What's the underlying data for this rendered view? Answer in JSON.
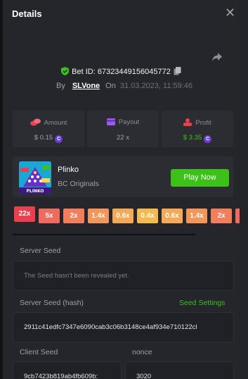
{
  "header": {
    "title": "Details"
  },
  "bet": {
    "id_text": "Bet ID: 67323449156045772",
    "by_label": "By",
    "user": "SLVone",
    "on_label": "On",
    "date": "31.03.2023, 11:59:46"
  },
  "stats": {
    "amount": {
      "label": "Amount",
      "value": "$ 0.15"
    },
    "payout": {
      "label": "Payout",
      "value": "22 x"
    },
    "profit": {
      "label": "Profit",
      "value": "$ 3.35"
    }
  },
  "game": {
    "name": "Plinko",
    "provider": "BC Originals",
    "thumb_text": "PLINKO",
    "play_label": "Play Now"
  },
  "multipliers": [
    "22x",
    "5x",
    "2x",
    "1.4x",
    "0.6x",
    "0.4x",
    "0.6x",
    "1.4x",
    "2x"
  ],
  "server_seed": {
    "label": "Server Seed",
    "value": "The Seed hasn't been revealed yet."
  },
  "server_seed_hash": {
    "label": "Server Seed (hash)",
    "settings_link": "Seed Settings",
    "value": "2911c41edfc7347e6090cab3c06b3148ce4af934e710122cl"
  },
  "client_seed": {
    "label": "Client Seed",
    "value": "9cb7423b819ab4fb609b:"
  },
  "nonce": {
    "label": "nonce",
    "value": "3020"
  },
  "colors": {
    "accent_green": "#3bc117",
    "coin_purple": "#6b3fd4",
    "mult_red": "#e8404f",
    "mult_salmon": "#f06a5e",
    "mult_orange": "#f4955a",
    "mult_yellow": "#f5b94f"
  }
}
